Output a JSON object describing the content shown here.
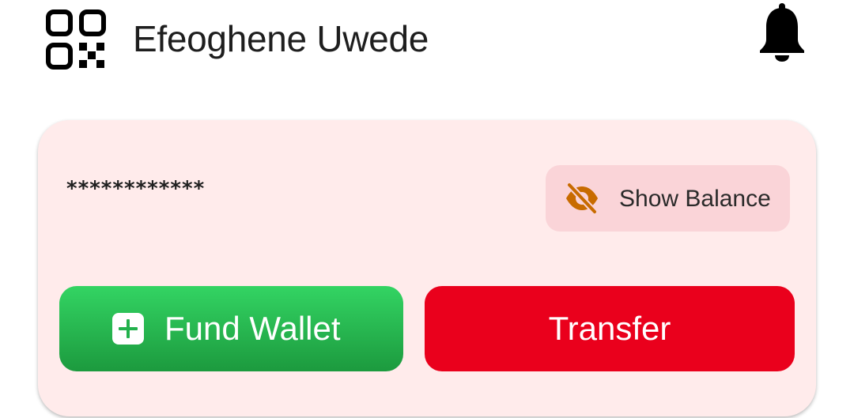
{
  "header": {
    "qr_icon": "qr-code-icon",
    "user_name": "Efeoghene Uwede",
    "notification_icon": "bell-icon"
  },
  "wallet": {
    "masked_balance": "************",
    "show_balance": {
      "label": "Show Balance",
      "icon": "eye-slash-icon",
      "icon_color": "#c86b00"
    },
    "actions": {
      "fund": {
        "label": "Fund Wallet",
        "icon": "plus-square-icon",
        "color": "#22b14c"
      },
      "transfer": {
        "label": "Transfer",
        "color": "#ea001c"
      }
    },
    "card_color": "#ffebeb"
  }
}
